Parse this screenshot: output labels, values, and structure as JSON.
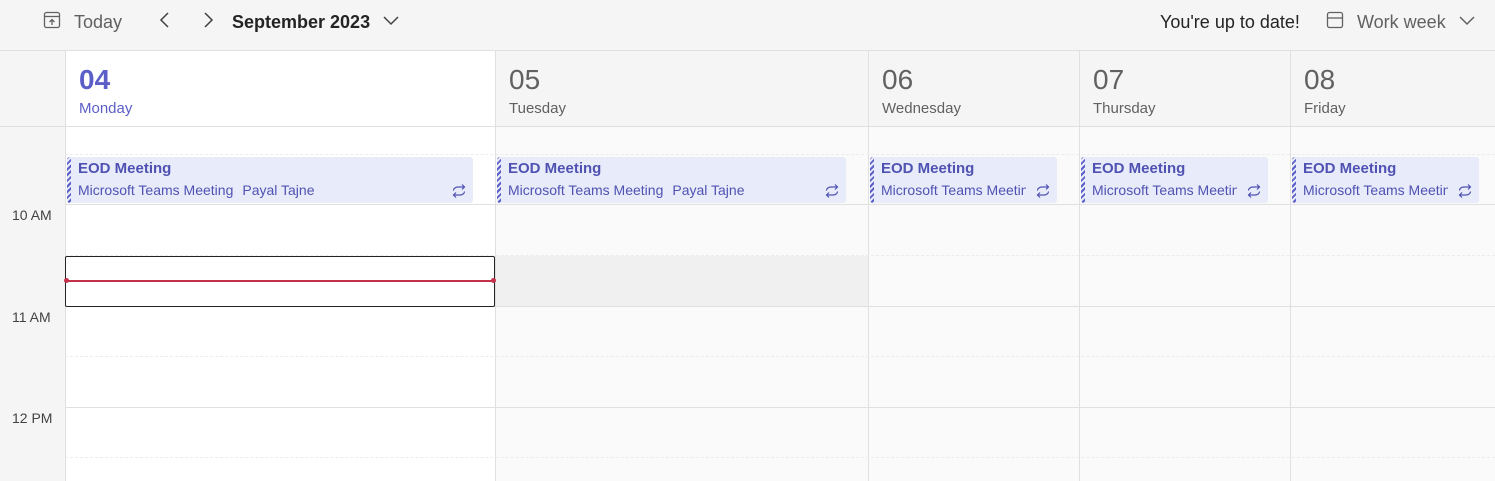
{
  "toolbar": {
    "today_label": "Today",
    "month_label": "September 2023",
    "sync_status": "You're up to date!",
    "view_label": "Work week"
  },
  "days": [
    {
      "num": "04",
      "name": "Monday",
      "is_today": true
    },
    {
      "num": "05",
      "name": "Tuesday",
      "is_today": false
    },
    {
      "num": "06",
      "name": "Wednesday",
      "is_today": false
    },
    {
      "num": "07",
      "name": "Thursday",
      "is_today": false
    },
    {
      "num": "08",
      "name": "Friday",
      "is_today": false
    }
  ],
  "time_labels": [
    "10 AM",
    "11 AM",
    "12 PM"
  ],
  "events": [
    {
      "title": "EOD Meeting",
      "location": "Microsoft Teams Meeting",
      "organizer": "Payal Tajne",
      "recurring": true
    },
    {
      "title": "EOD Meeting",
      "location": "Microsoft Teams Meeting",
      "organizer": "Payal Tajne",
      "recurring": true
    },
    {
      "title": "EOD Meeting",
      "location": "Microsoft Teams Meeting",
      "organizer": "",
      "recurring": true
    },
    {
      "title": "EOD Meeting",
      "location": "Microsoft Teams Meeting",
      "organizer": "",
      "recurring": true
    },
    {
      "title": "EOD Meeting",
      "location": "Microsoft Teams Meeting",
      "organizer": "",
      "recurring": true
    }
  ],
  "colors": {
    "accent": "#5b5fc7",
    "event_bg": "#e8ebfa",
    "event_text": "#4f52b2",
    "now_line": "#c4314b"
  },
  "icons": {
    "today": "calendar-today-icon",
    "prev": "chevron-left-icon",
    "next": "chevron-right-icon",
    "month_dropdown": "chevron-down-icon",
    "view": "calendar-view-icon",
    "view_dropdown": "chevron-down-icon",
    "recurring": "recurring-icon"
  }
}
